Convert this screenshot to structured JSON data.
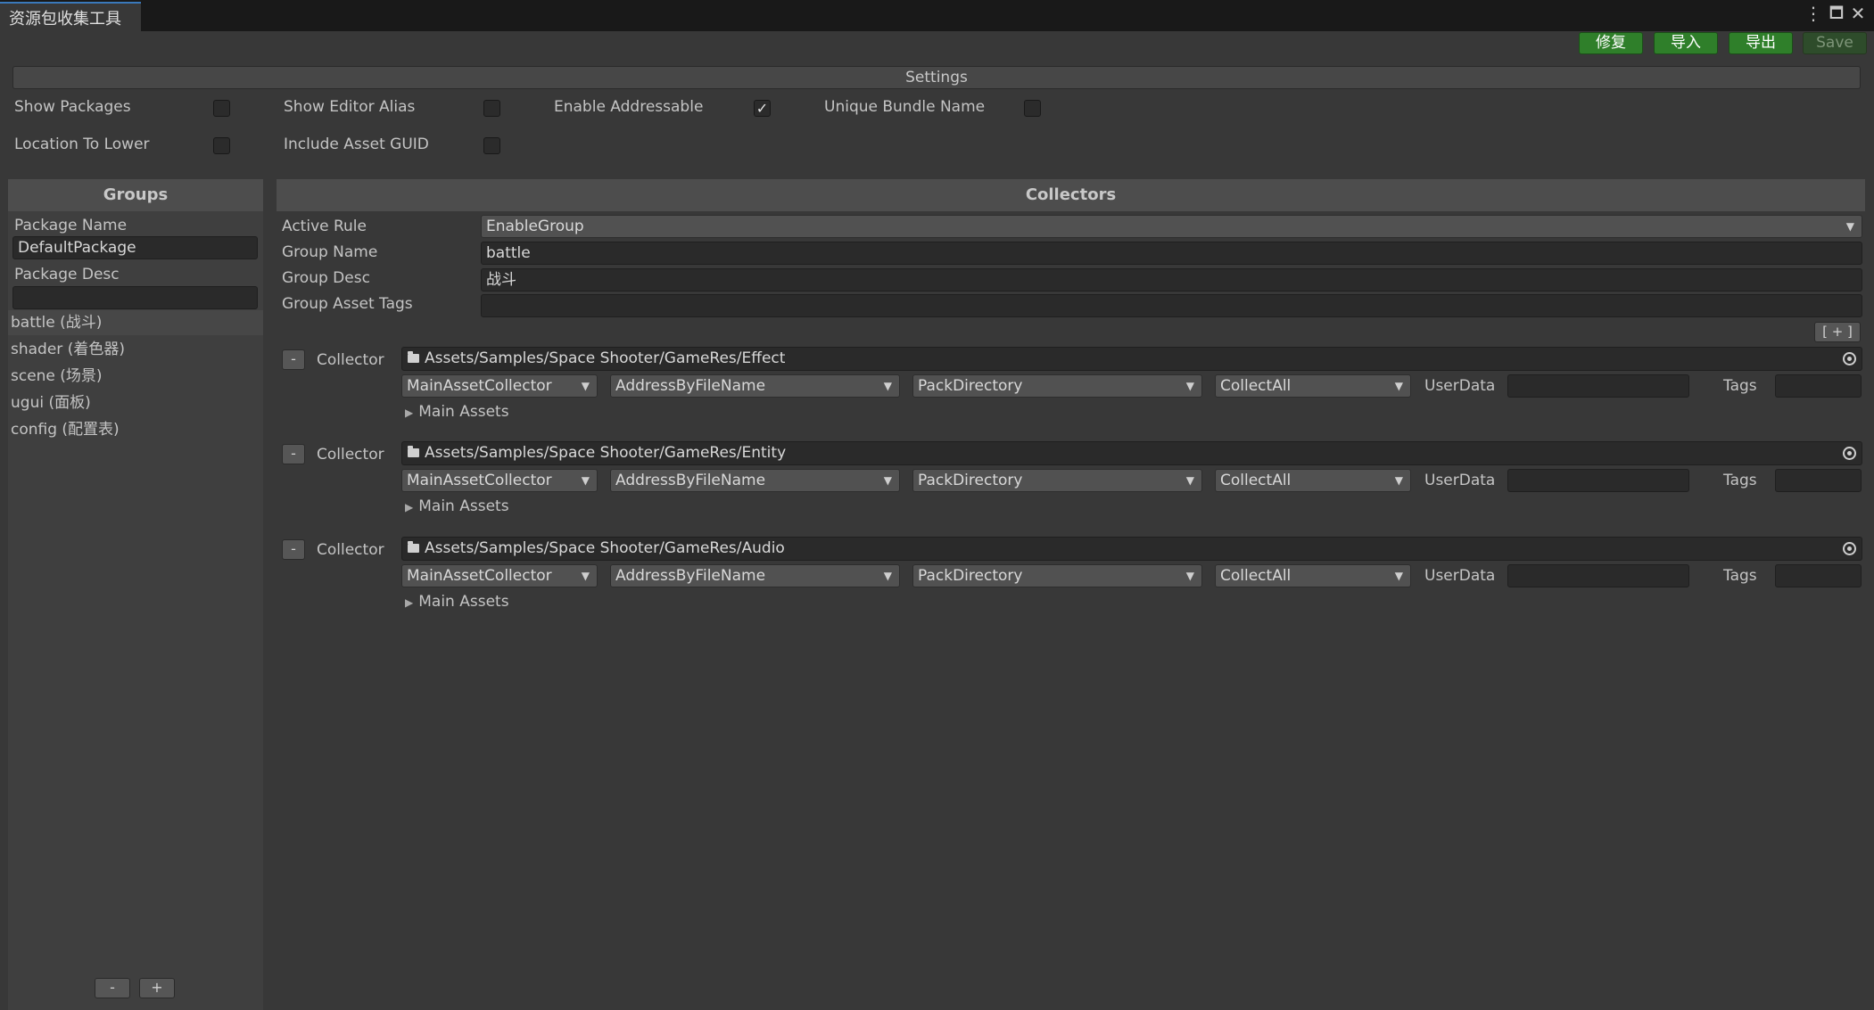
{
  "window": {
    "tab_title": "资源包收集工具",
    "menu_icon": "⋮",
    "maximize_icon": "🗖",
    "close_icon": "✕"
  },
  "toolbar": {
    "repair_label": "修复",
    "import_label": "导入",
    "export_label": "导出",
    "save_label": "Save"
  },
  "settings": {
    "header": "Settings",
    "show_packages": {
      "label": "Show Packages",
      "checked": false
    },
    "show_editor_alias": {
      "label": "Show Editor Alias",
      "checked": false
    },
    "enable_addressable": {
      "label": "Enable Addressable",
      "checked": true
    },
    "unique_bundle_name": {
      "label": "Unique Bundle Name",
      "checked": false
    },
    "location_to_lower": {
      "label": "Location To Lower",
      "checked": false
    },
    "include_asset_guid": {
      "label": "Include Asset GUID",
      "checked": false
    },
    "check_mark": "✓"
  },
  "groups": {
    "header": "Groups",
    "package_name_label": "Package Name",
    "package_name_value": "DefaultPackage",
    "package_desc_label": "Package Desc",
    "package_desc_value": "",
    "items": [
      {
        "label": "battle (战斗)",
        "selected": true
      },
      {
        "label": "shader (着色器)",
        "selected": false
      },
      {
        "label": "scene (场景)",
        "selected": false
      },
      {
        "label": "ugui (面板)",
        "selected": false
      },
      {
        "label": "config (配置表)",
        "selected": false
      }
    ],
    "remove_label": "-",
    "add_label": "+"
  },
  "collectors": {
    "header": "Collectors",
    "active_rule_label": "Active Rule",
    "active_rule_value": "EnableGroup",
    "group_name_label": "Group Name",
    "group_name_value": "battle",
    "group_desc_label": "Group Desc",
    "group_desc_value": "战斗",
    "group_tags_label": "Group Asset Tags",
    "group_tags_value": "",
    "add_collector_label": "[ + ]",
    "remove_label": "-",
    "collector_label": "Collector",
    "userdata_label": "UserData",
    "tags_label": "Tags",
    "main_assets_label": "Main Assets",
    "items": [
      {
        "path": "Assets/Samples/Space Shooter/GameRes/Effect",
        "collector_type": "MainAssetCollector",
        "address_rule": "AddressByFileName",
        "pack_rule": "PackDirectory",
        "filter_rule": "CollectAll",
        "userdata": "",
        "tags": ""
      },
      {
        "path": "Assets/Samples/Space Shooter/GameRes/Entity",
        "collector_type": "MainAssetCollector",
        "address_rule": "AddressByFileName",
        "pack_rule": "PackDirectory",
        "filter_rule": "CollectAll",
        "userdata": "",
        "tags": ""
      },
      {
        "path": "Assets/Samples/Space Shooter/GameRes/Audio",
        "collector_type": "MainAssetCollector",
        "address_rule": "AddressByFileName",
        "pack_rule": "PackDirectory",
        "filter_rule": "CollectAll",
        "userdata": "",
        "tags": ""
      }
    ]
  },
  "colors": {
    "accent_green": "#2f7f2a",
    "panel_bg": "#383838",
    "field_bg": "#2a2a2a"
  }
}
